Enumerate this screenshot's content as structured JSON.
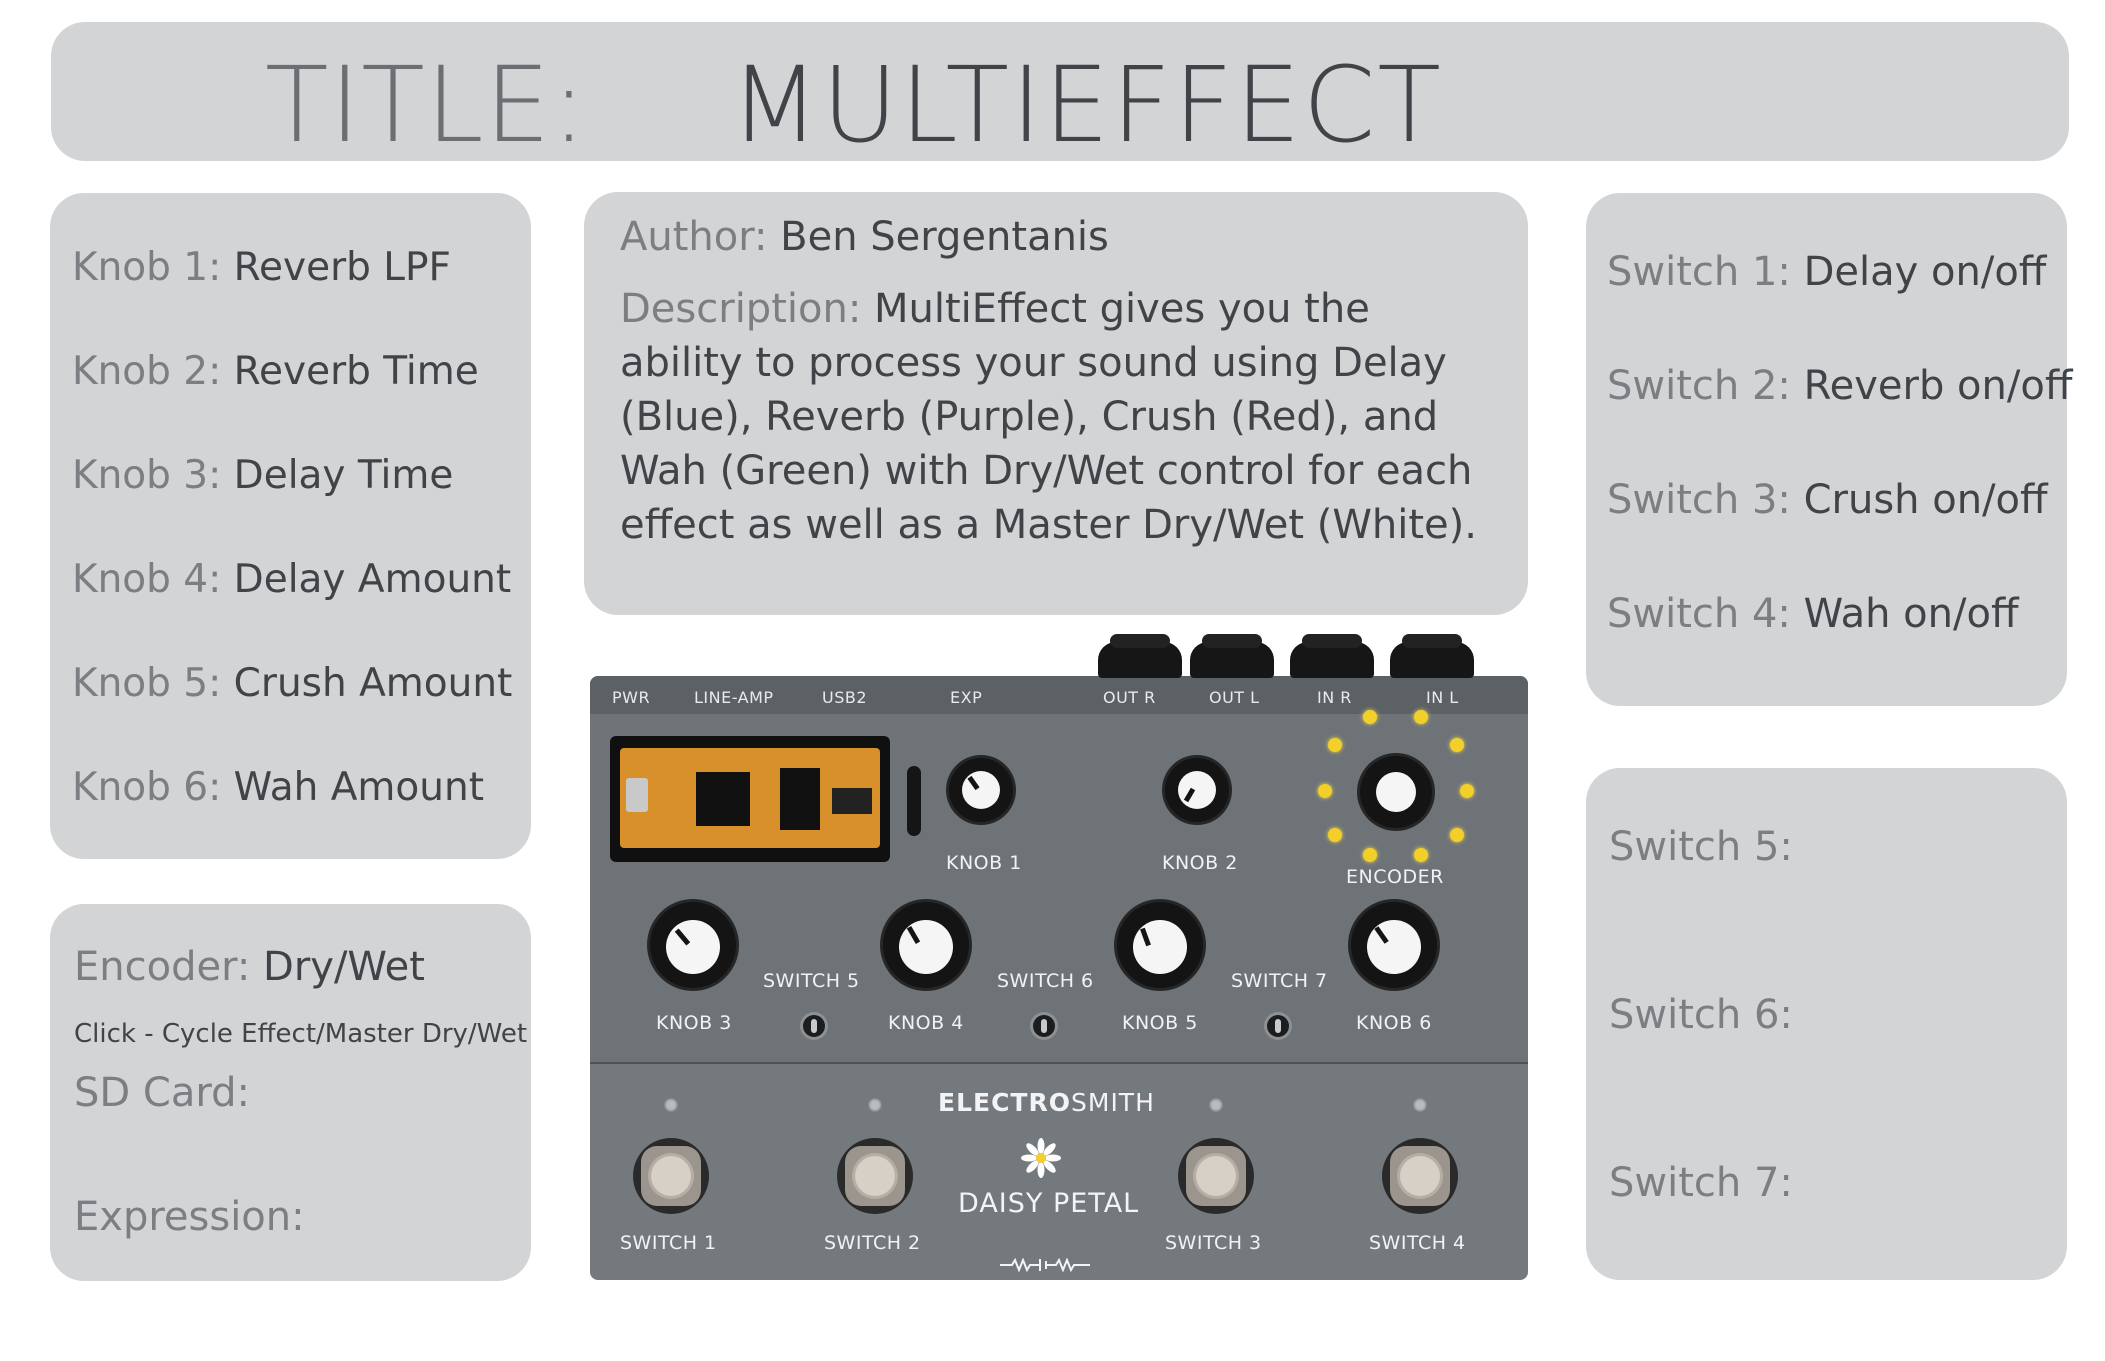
{
  "title": {
    "label": "TITLE:",
    "value": "MULTIEFFECT"
  },
  "knobs": [
    {
      "label": "Knob 1:",
      "value": "Reverb LPF"
    },
    {
      "label": "Knob 2:",
      "value": "Reverb Time"
    },
    {
      "label": "Knob 3:",
      "value": "Delay Time"
    },
    {
      "label": "Knob 4:",
      "value": "Delay Amount"
    },
    {
      "label": "Knob 5:",
      "value": "Crush Amount"
    },
    {
      "label": "Knob 6:",
      "value": "Wah Amount"
    }
  ],
  "encoder": {
    "label": "Encoder:",
    "value": "Dry/Wet",
    "click_note": "Click - Cycle Effect/Master Dry/Wet",
    "sd_label": "SD Card:",
    "expression_label": "Expression:"
  },
  "author": {
    "label": "Author:",
    "value": "Ben Sergentanis"
  },
  "description": {
    "label": "Description:",
    "value": "MultiEffect gives you the ability to process your sound using Delay (Blue), Reverb (Purple), Crush (Red), and Wah (Green) with Dry/Wet control for each effect as well as a Master Dry/Wet (White)."
  },
  "switches": [
    {
      "label": "Switch 1:",
      "value": "Delay on/off"
    },
    {
      "label": "Switch 2:",
      "value": "Reverb on/off"
    },
    {
      "label": "Switch 3:",
      "value": "Crush on/off"
    },
    {
      "label": "Switch 4:",
      "value": "Wah on/off"
    },
    {
      "label": "Switch 5:",
      "value": ""
    },
    {
      "label": "Switch 6:",
      "value": ""
    },
    {
      "label": "Switch 7:",
      "value": ""
    }
  ],
  "pedal": {
    "ports": [
      "PWR",
      "LINE-AMP",
      "USB2",
      "EXP",
      "OUT R",
      "OUT L",
      "IN R",
      "IN L"
    ],
    "knob_labels": [
      "KNOB 1",
      "KNOB 2",
      "KNOB 3",
      "KNOB 4",
      "KNOB 5",
      "KNOB 6"
    ],
    "encoder_label": "ENCODER",
    "toggle_labels": [
      "SWITCH 5",
      "SWITCH 6",
      "SWITCH 7"
    ],
    "footswitch_labels": [
      "SWITCH 1",
      "SWITCH 2",
      "SWITCH 3",
      "SWITCH 4"
    ],
    "brand_bold": "ELECTRO",
    "brand_light": "SMITH",
    "product": "DAISY PETAL",
    "encoder_led_color": "#f3cf2a",
    "flower_icon": "daisy-flower-icon"
  },
  "colors": {
    "panel": "#d2d4d6",
    "label": "#7b7e82",
    "value": "#404347",
    "pedal": "#6e7378"
  }
}
